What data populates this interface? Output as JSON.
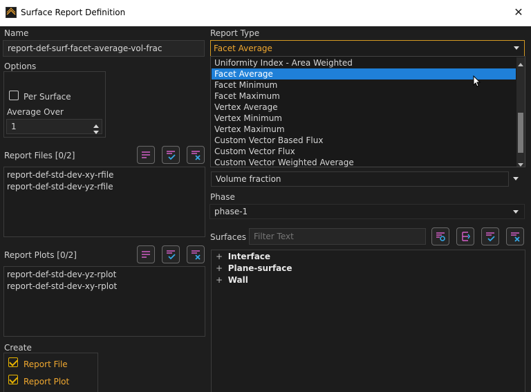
{
  "window": {
    "title": "Surface Report Definition",
    "close_glyph": "✕"
  },
  "name": {
    "label": "Name",
    "value": "report-def-surf-facet-average-vol-frac"
  },
  "options": {
    "label": "Options",
    "per_surface": {
      "label": "Per Surface",
      "checked": false
    },
    "average_over": {
      "label": "Average Over",
      "value": "1"
    }
  },
  "report_files": {
    "label": "Report Files  [0/2]",
    "items": [
      "report-def-std-dev-xy-rfile",
      "report-def-std-dev-yz-rfile"
    ]
  },
  "report_plots": {
    "label": "Report Plots  [0/2]",
    "items": [
      "report-def-std-dev-yz-rplot",
      "report-def-std-dev-xy-rplot"
    ]
  },
  "create": {
    "label": "Create",
    "report_file": {
      "label": "Report File",
      "checked": true
    },
    "report_plot": {
      "label": "Report Plot",
      "checked": true
    }
  },
  "report_type": {
    "label": "Report Type",
    "selected": "Facet Average",
    "options": [
      "Uniformity Index - Area Weighted",
      "Facet Average",
      "Facet Minimum",
      "Facet Maximum",
      "Vertex Average",
      "Vertex Minimum",
      "Vertex Maximum",
      "Custom Vector Based Flux",
      "Custom Vector Flux",
      "Custom Vector Weighted Average"
    ],
    "highlighted_index": 1
  },
  "field_variable": {
    "value": "Volume fraction"
  },
  "phase": {
    "label": "Phase",
    "value": "phase-1"
  },
  "surfaces": {
    "label": "Surfaces",
    "filter_placeholder": "Filter Text",
    "tree": [
      "Interface",
      "Plane-surface",
      "Wall"
    ]
  },
  "icons": {
    "list-icon": "lines",
    "select-all-icon": "check",
    "deselect-all-icon": "x",
    "filter-circle-icon": "circle",
    "sort-icon": "arrows"
  },
  "colors": {
    "accent": "#f0a830",
    "highlight": "#1f80d8",
    "icon_purple": "#d45ec8",
    "icon_blue": "#35a8e8"
  }
}
